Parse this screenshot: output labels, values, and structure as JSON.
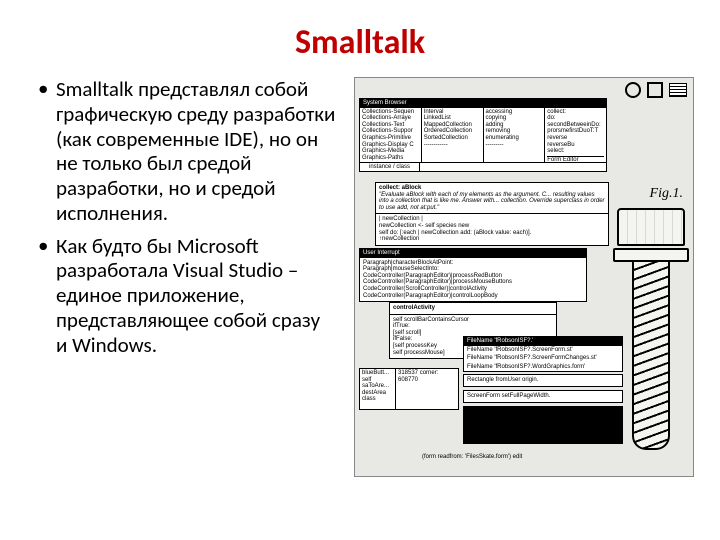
{
  "title": "Smalltalk",
  "bullets": [
    "Smalltalk представлял собой графическую среду разработки (как современные IDE), но он не только был средой разработки, но и средой исполнения.",
    "Как будто бы Microsoft разработала Visual Studio – единое приложение, представляющее собой сразу и Windows."
  ],
  "screenshot": {
    "figLabel": "Fig.1.",
    "windows": {
      "browser": {
        "title": "System Browser",
        "col1": [
          "Collections-Sequen",
          "Collections-Arraye",
          "Collections-Text",
          "Collections-Suppor",
          "Graphics-Primitive",
          "Graphics-Display C",
          "Graphics-Media",
          "Graphics-Paths"
        ],
        "col2": [
          "Interval",
          "LinkedList",
          "MappedCollection",
          "OrderedCollection",
          "SortedCollection",
          "------------"
        ],
        "col3": [
          "accessing",
          "copying",
          "adding",
          "removing",
          "enumerating",
          "---------"
        ],
        "col4": [
          "collect:",
          "do:",
          "secondBetweeinDo:",
          "prorsmefirstDuoT:T",
          "reverse",
          "reverseBu",
          "select:"
        ],
        "classInstance": "instance / class",
        "editor": "Form Editor"
      },
      "collect": {
        "title": "collect: aBlock",
        "text": "\"Evaluate aBlock with each of my elements as the argument. C... resulting values into a collection that is like me. Answer with... collection. Override superclass in order to use add, not at:put.\"",
        "code": [
          "| newCollection |",
          "newCollection <- self species new",
          "self do: [:each | newCollection add: (aBlock value: each)].",
          "↑newCollection"
        ]
      },
      "inspector": {
        "title": "User Interrupt",
        "lines": [
          "Paragraph|characterBlockAtPoint:",
          "Paragraph|mouseSelectInto:",
          "CodeController(ParagraphEditor)|processRedButton",
          "CodeController(ParagraphEditor)|processMouseButtons",
          "CodeController(ScrollController)|controlActivity",
          "CodeController(ParagraphEditor)|controlLoopBody"
        ]
      },
      "activity": {
        "title": "controlActivity",
        "code": [
          "self scrollBarContainsCursor",
          "    ifTrue:",
          "        [self scroll]",
          "    ifFalse:",
          "        [self processKey",
          "         self processMouse]"
        ]
      },
      "files": {
        "lines": [
          "FileName 'fRobsonISF?.'",
          "FileName 'fRobsonISF?.ScreenForm.st'",
          "FileName 'fRobsonISF?.ScreenFormChanges.st'",
          "FileName 'fRobsonISF?.WordGraphics.form'"
        ]
      },
      "rect": "Rectangle fromUser origin.",
      "width": "ScreenForm setFullPageWidth.",
      "footer": "(form readfrom: 'FilesSkate.form') edit",
      "blueDot": {
        "label": "blueButt...",
        "vals": [
          "318537 corner:",
          "608770"
        ],
        "side": [
          "self",
          "saToAre...",
          "destArea",
          "class"
        ]
      }
    }
  }
}
